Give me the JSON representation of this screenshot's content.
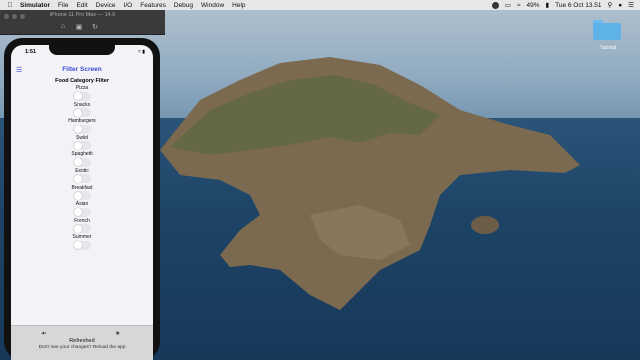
{
  "menubar": {
    "app": "Simulator",
    "items": [
      "File",
      "Edit",
      "Device",
      "I/O",
      "Features",
      "Debug",
      "Window",
      "Help"
    ],
    "battery": "49%",
    "clock": "Tue 6 Oct  13.51"
  },
  "simulator": {
    "title": "iPhone 11 Pro Max — 14.0"
  },
  "phone": {
    "time": "1:51",
    "nav_title": "Filter Screen",
    "section_title": "Food Category Filter",
    "filters": [
      {
        "label": "Pizza",
        "on": false
      },
      {
        "label": "Snacks",
        "on": false
      },
      {
        "label": "Hamburgers",
        "on": false
      },
      {
        "label": "Swiid",
        "on": false
      },
      {
        "label": "Spaghetti",
        "on": false
      },
      {
        "label": "Exotic",
        "on": false
      },
      {
        "label": "Breakfast",
        "on": false
      },
      {
        "label": "Asian",
        "on": false
      },
      {
        "label": "French",
        "on": false
      },
      {
        "label": "Summer",
        "on": false
      }
    ],
    "toast_title": "Refreshed",
    "toast_subtitle": "Don't see your changes? Reload the app"
  },
  "desktop": {
    "folder_label": "Tutorial"
  },
  "colors": {
    "accent": "#3b4ad1",
    "folder": "#5fb2e7"
  },
  "icons": {
    "menu": "hamburger-icon",
    "tab_left": "meals-icon",
    "tab_right": "star-icon"
  }
}
